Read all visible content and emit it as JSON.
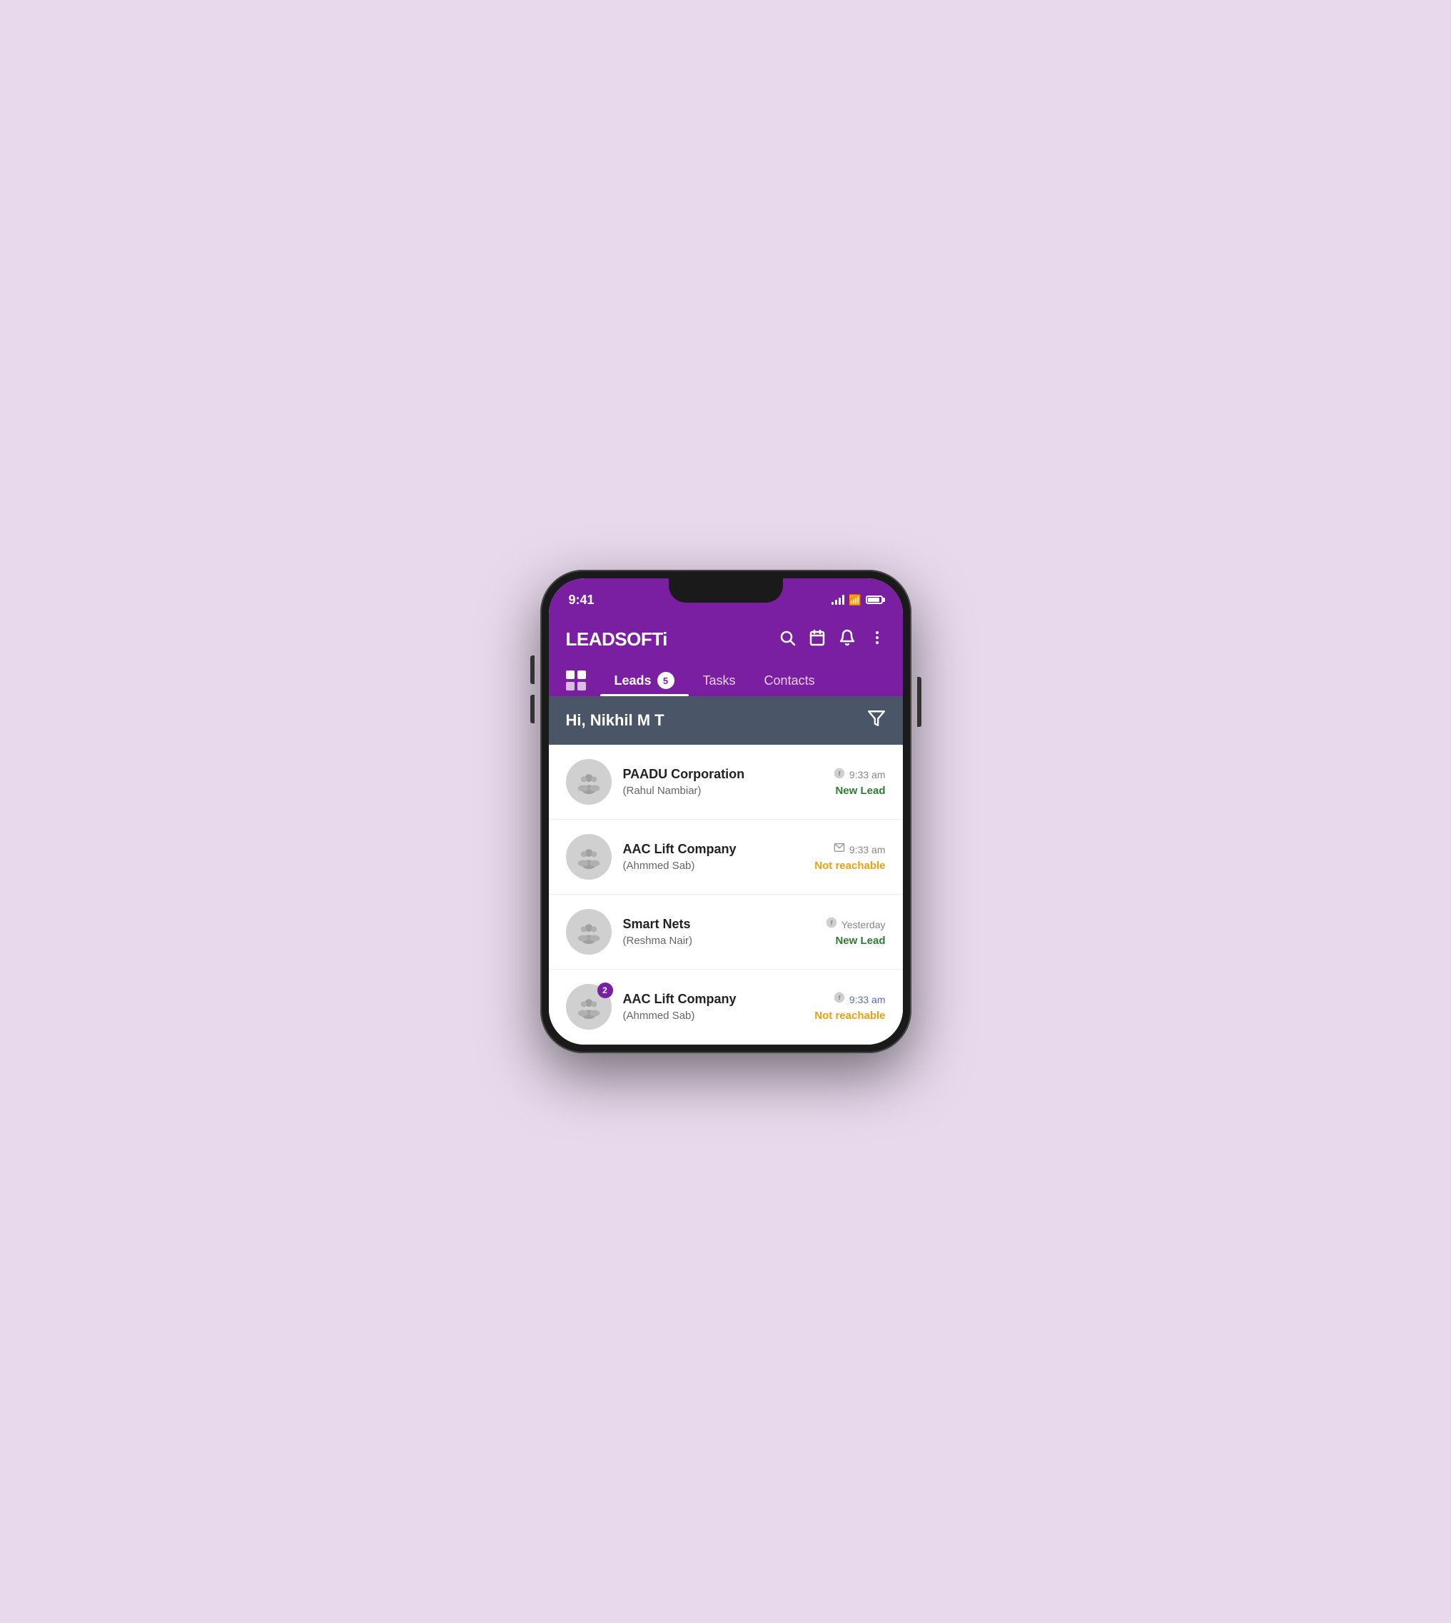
{
  "status_bar": {
    "time": "9:41"
  },
  "header": {
    "logo": "LEADSOFTi",
    "actions": [
      "search",
      "calendar",
      "bell",
      "more"
    ]
  },
  "tabs": {
    "grid_icon": true,
    "items": [
      {
        "label": "Leads",
        "badge": "5",
        "active": true
      },
      {
        "label": "Tasks",
        "active": false
      },
      {
        "label": "Contacts",
        "active": false
      }
    ]
  },
  "greeting": {
    "text": "Hi, Nikhil M T"
  },
  "leads": [
    {
      "company": "PAADU Corporation",
      "contact": "(Rahul Nambiar)",
      "source": "facebook",
      "time": "9:33 am",
      "time_color": "normal",
      "status": "New Lead",
      "status_color": "green",
      "badge": null
    },
    {
      "company": "AAC Lift Company",
      "contact": "(Ahmmed Sab)",
      "source": "email",
      "time": "9:33 am",
      "time_color": "normal",
      "status": "Not reachable",
      "status_color": "orange",
      "badge": null
    },
    {
      "company": "Smart Nets",
      "contact": "(Reshma Nair)",
      "source": "facebook",
      "time": "Yesterday",
      "time_color": "normal",
      "status": "New Lead",
      "status_color": "green",
      "badge": null
    },
    {
      "company": "AAC Lift Company",
      "contact": "(Ahmmed Sab)",
      "source": "facebook",
      "time": "9:33 am",
      "time_color": "blue",
      "status": "Not reachable",
      "status_color": "orange",
      "badge": "2"
    }
  ]
}
